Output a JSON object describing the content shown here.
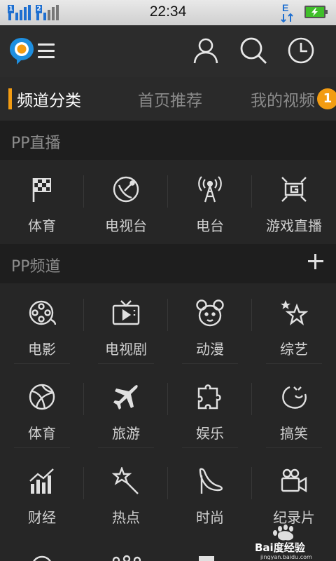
{
  "status_bar": {
    "time": "22:34",
    "sim1": "1",
    "sim2": "2",
    "network": "E"
  },
  "tabs": [
    {
      "label": "频道分类",
      "active": true
    },
    {
      "label": "首页推荐",
      "active": false
    },
    {
      "label": "我的视频",
      "active": false,
      "badge": "1"
    }
  ],
  "sections": {
    "live": {
      "title": "PP直播"
    },
    "channels": {
      "title": "PP频道"
    }
  },
  "live_items": [
    {
      "label": "体育",
      "icon": "checkered-flag-icon"
    },
    {
      "label": "电视台",
      "icon": "satellite-dish-icon"
    },
    {
      "label": "电台",
      "icon": "radio-tower-icon"
    },
    {
      "label": "游戏直播",
      "icon": "game-live-icon"
    }
  ],
  "channel_items": [
    {
      "label": "电影",
      "icon": "film-reel-icon"
    },
    {
      "label": "电视剧",
      "icon": "tv-icon"
    },
    {
      "label": "动漫",
      "icon": "mouse-head-icon"
    },
    {
      "label": "综艺",
      "icon": "stars-icon"
    },
    {
      "label": "体育",
      "icon": "ball-icon"
    },
    {
      "label": "旅游",
      "icon": "airplane-icon"
    },
    {
      "label": "娱乐",
      "icon": "puzzle-icon"
    },
    {
      "label": "搞笑",
      "icon": "laugh-face-icon"
    },
    {
      "label": "财经",
      "icon": "bar-chart-icon"
    },
    {
      "label": "热点",
      "icon": "magic-wand-icon"
    },
    {
      "label": "时尚",
      "icon": "high-heel-icon"
    },
    {
      "label": "纪录片",
      "icon": "video-camera-icon"
    }
  ],
  "watermark": {
    "brand": "Bai度经验",
    "url": "jingyan.baidu.com"
  },
  "colors": {
    "accent": "#f39c12",
    "background": "#262626",
    "section_bg": "#1e1e1e"
  }
}
